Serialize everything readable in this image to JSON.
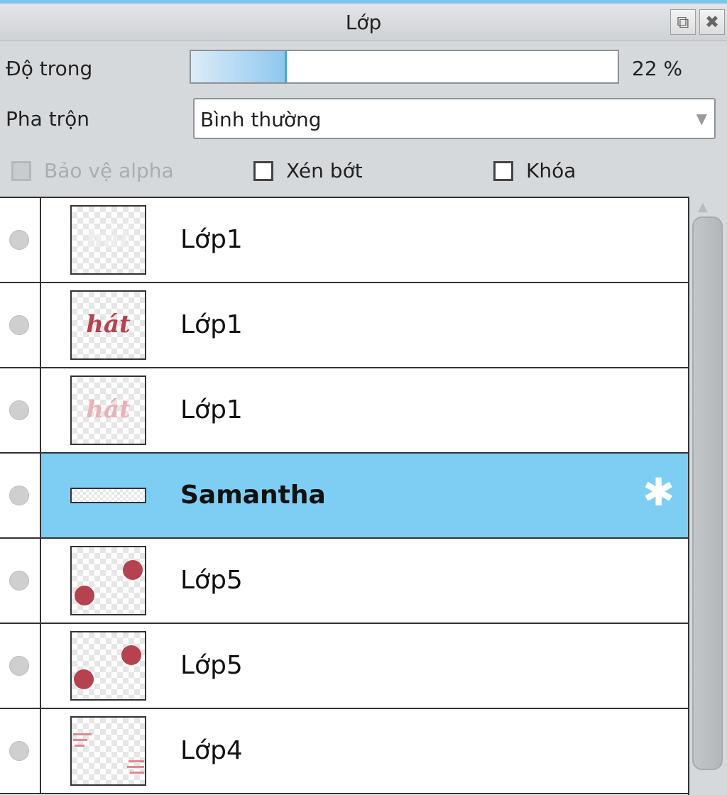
{
  "window": {
    "title": "Lớp",
    "undock_icon": "undock-icon",
    "close_icon": "close-icon"
  },
  "opacity": {
    "label": "Độ trong",
    "value_text": "22 %",
    "value": 0.22
  },
  "blend": {
    "label": "Pha trộn",
    "value": "Bình thường"
  },
  "checkboxes": [
    {
      "label": "Bảo vệ alpha",
      "checked": false,
      "enabled": false
    },
    {
      "label": "Xén bớt",
      "checked": false,
      "enabled": true
    },
    {
      "label": "Khóa",
      "checked": false,
      "enabled": true
    }
  ],
  "layers": [
    {
      "name": "Lớp1",
      "thumb_text": "hát",
      "selected": false
    },
    {
      "name": "Lớp1",
      "thumb_text": "hát",
      "selected": false
    },
    {
      "name": "Lớp1",
      "thumb_text": "hát",
      "selected": false
    },
    {
      "name": "Samantha",
      "selected": true,
      "icon": "gear-icon"
    },
    {
      "name": "Lớp5",
      "selected": false
    },
    {
      "name": "Lớp5",
      "selected": false
    },
    {
      "name": "Lớp4",
      "selected": false
    }
  ],
  "colors": {
    "accent": "#7ecef4",
    "thumb_red": "#b5424f"
  }
}
